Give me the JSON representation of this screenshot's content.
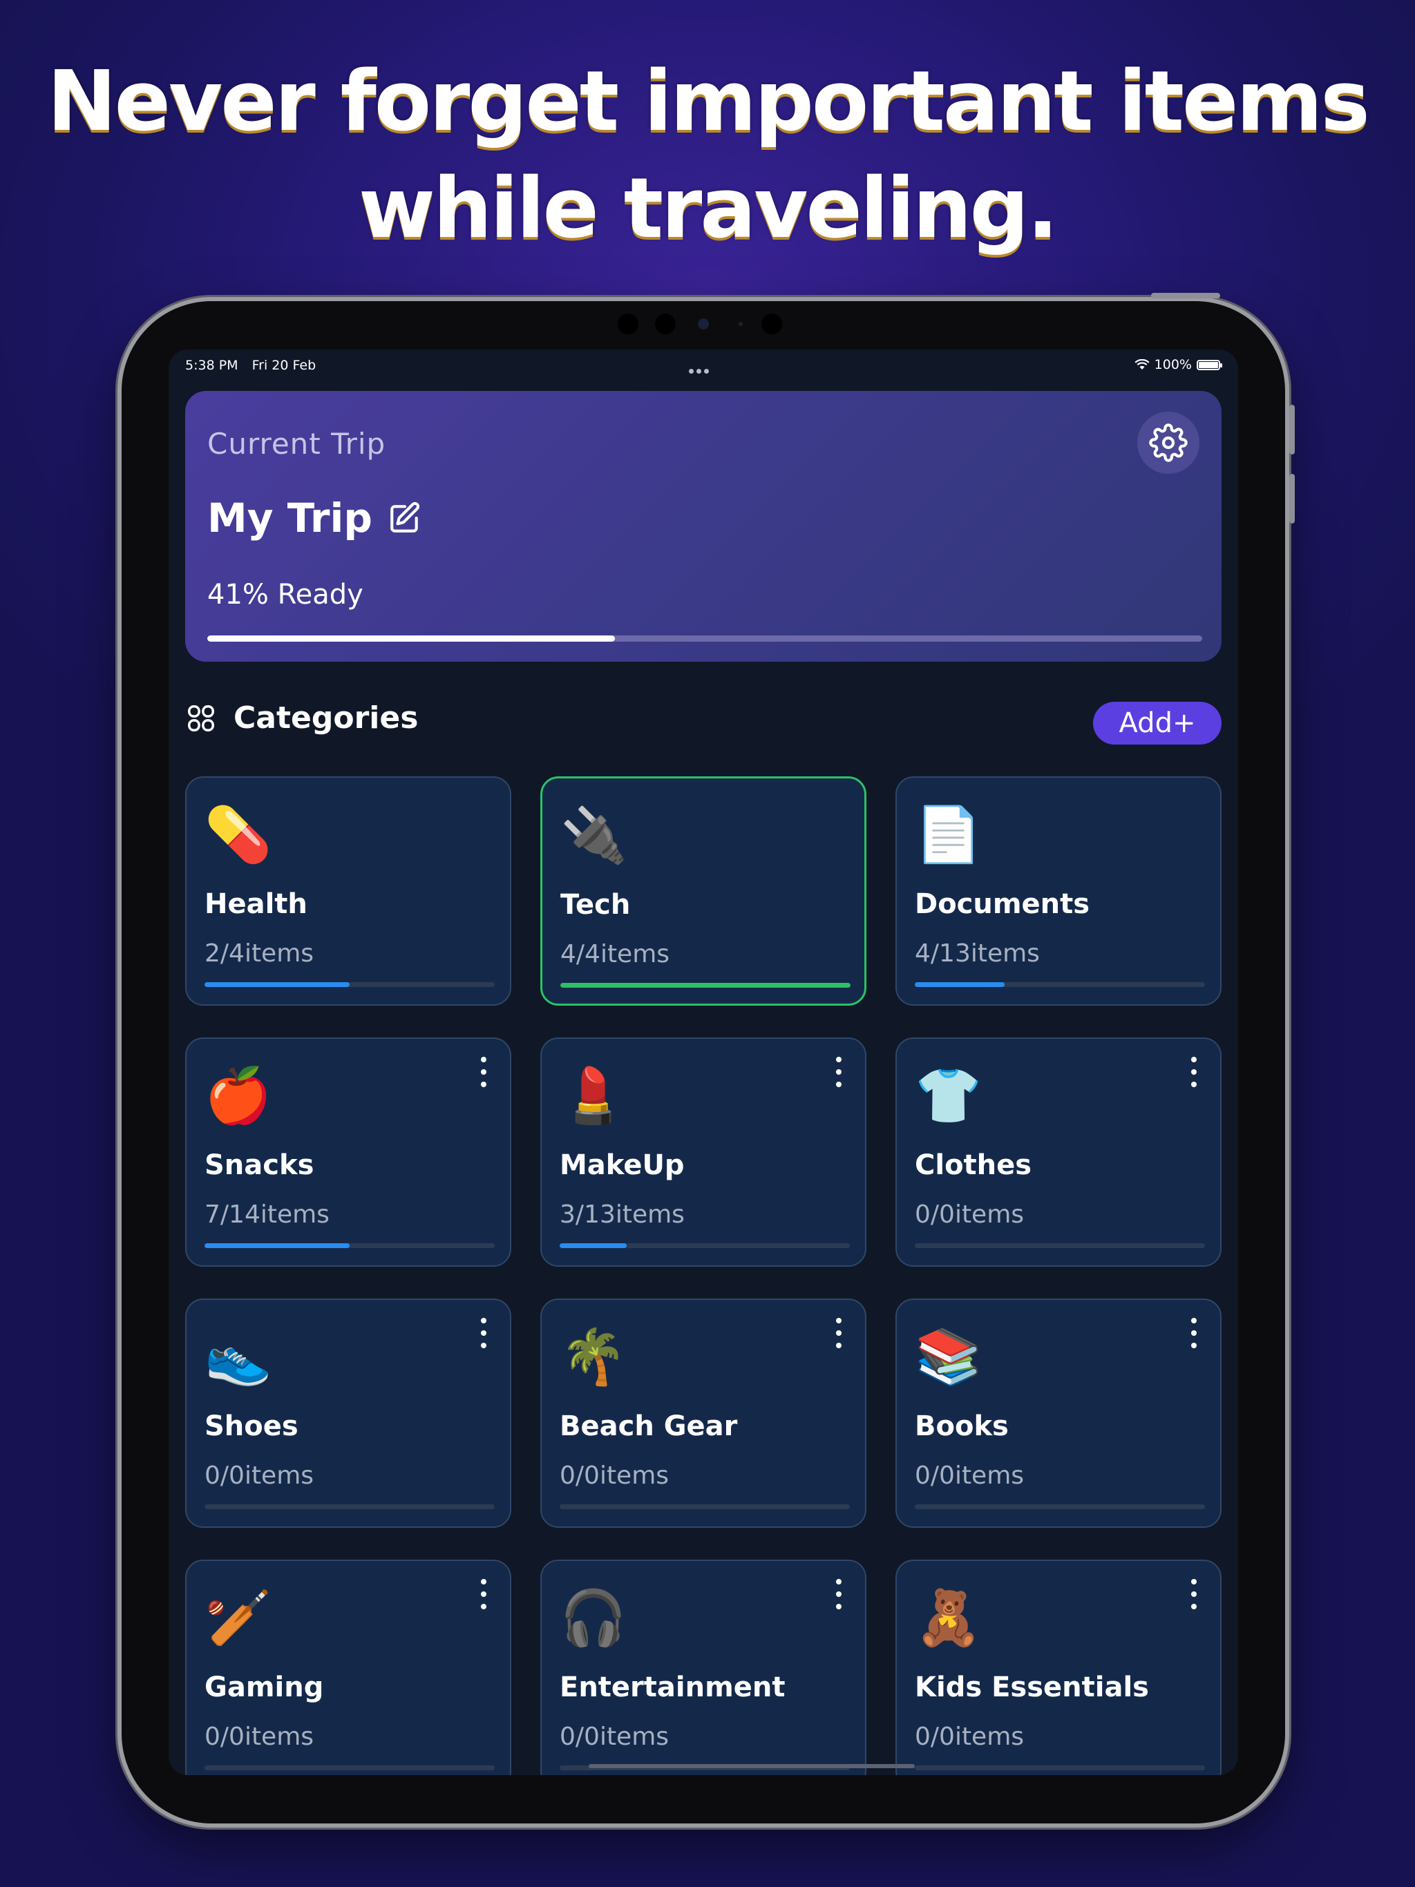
{
  "headline": {
    "line1": "Never forget important items",
    "line2": "while traveling."
  },
  "status_bar": {
    "time": "5:38 PM",
    "date": "Fri 20 Feb",
    "battery": "100%"
  },
  "trip": {
    "label": "Current Trip",
    "name": "My Trip",
    "ready_text": "41% Ready",
    "progress": 0.41
  },
  "categories": {
    "title": "Categories",
    "add_label": "Add+",
    "items": [
      {
        "emoji": "💊",
        "title": "Health",
        "count": "2/4items",
        "progress": 0.5,
        "menu": false,
        "complete": false
      },
      {
        "emoji": "🔌",
        "title": "Tech",
        "count": "4/4items",
        "progress": 1.0,
        "menu": false,
        "complete": true
      },
      {
        "emoji": "📄",
        "title": "Documents",
        "count": "4/13items",
        "progress": 0.31,
        "menu": false,
        "complete": false
      },
      {
        "emoji": "🍎",
        "title": "Snacks",
        "count": "7/14items",
        "progress": 0.5,
        "menu": true,
        "complete": false
      },
      {
        "emoji": "💄",
        "title": "MakeUp",
        "count": "3/13items",
        "progress": 0.23,
        "menu": true,
        "complete": false
      },
      {
        "emoji": "👕",
        "title": "Clothes",
        "count": "0/0items",
        "progress": 0,
        "menu": true,
        "complete": false
      },
      {
        "emoji": "👟",
        "title": "Shoes",
        "count": "0/0items",
        "progress": 0,
        "menu": true,
        "complete": false
      },
      {
        "emoji": "🌴",
        "title": "Beach Gear",
        "count": "0/0items",
        "progress": 0,
        "menu": true,
        "complete": false
      },
      {
        "emoji": "📚",
        "title": "Books",
        "count": "0/0items",
        "progress": 0,
        "menu": true,
        "complete": false
      },
      {
        "emoji": "🏏",
        "title": "Gaming",
        "count": "0/0items",
        "progress": 0,
        "menu": true,
        "complete": false
      },
      {
        "emoji": "🎧",
        "title": "Entertainment",
        "count": "0/0items",
        "progress": 0,
        "menu": true,
        "complete": false
      },
      {
        "emoji": "🧸",
        "title": "Kids Essentials",
        "count": "0/0items",
        "progress": 0,
        "menu": true,
        "complete": false
      }
    ]
  },
  "icons": {
    "settings": "gear-icon",
    "edit": "pencil-edit-icon",
    "categories": "grid-icon",
    "more": "more-vertical-icon"
  }
}
